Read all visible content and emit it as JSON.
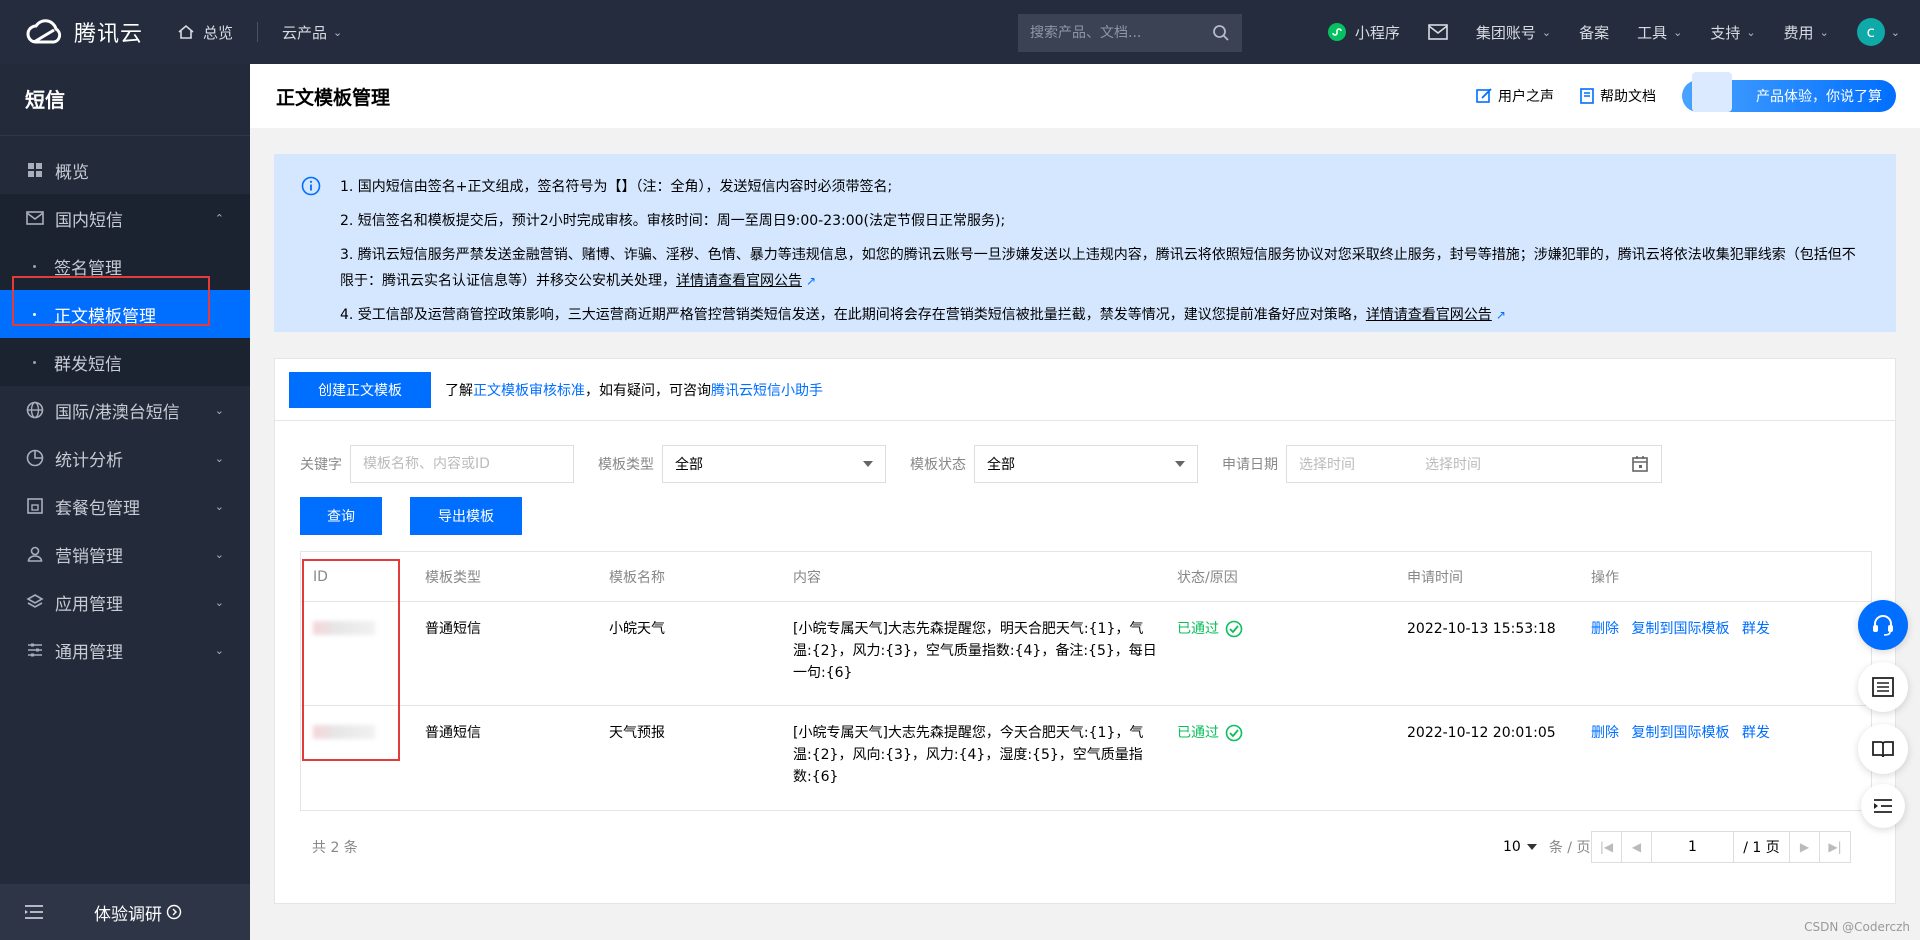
{
  "topbar": {
    "logo_text": "腾讯云",
    "home_label": "总览",
    "products_label": "云产品",
    "search_placeholder": "搜索产品、文档...",
    "mini_program": "小程序",
    "group_account": "集团账号",
    "beian": "备案",
    "tools": "工具",
    "support": "支持",
    "fees": "费用",
    "avatar_letter": "c"
  },
  "sidebar": {
    "title": "短信",
    "overview": "概览",
    "domestic": "国内短信",
    "sign_manage": "签名管理",
    "template_manage": "正文模板管理",
    "group_send": "群发短信",
    "intl": "国际/港澳台短信",
    "stats": "统计分析",
    "package": "套餐包管理",
    "marketing": "营销管理",
    "app_manage": "应用管理",
    "general": "通用管理",
    "survey": "体验调研"
  },
  "header": {
    "title": "正文模板管理",
    "user_voice": "用户之声",
    "help_doc": "帮助文档",
    "banner": "产品体验，你说了算"
  },
  "notice": {
    "items": [
      "1. 国内短信由签名+正文组成，签名符号为【】（注：全角），发送短信内容时必须带签名;",
      "2. 短信签名和模板提交后，预计2小时完成审核。审核时间：周一至周日9:00-23:00(法定节假日正常服务);",
      "3. 腾讯云短信服务严禁发送金融营销、赌博、诈骗、淫秽、色情、暴力等违规信息，如您的腾讯云账号一旦涉嫌发送以上违规内容，腾讯云将依照短信服务协议对您采取终止服务，封号等措施；涉嫌犯罪的，腾讯云将依法收集犯罪线索（包括但不限于：腾讯云实名认证信息等）并移交公安机关处理，",
      "4. 受工信部及运营商管控政策影响，三大运营商近期严格管控营销类短信发送，在此期间将会存在营销类短信被批量拦截，禁发等情况，建议您提前准备好应对策略，"
    ],
    "link3": "详情请查看官网公告",
    "link4": "详情请查看官网公告"
  },
  "toolbar": {
    "create_btn": "创建正文模板",
    "tip_prefix": "了解",
    "tip_link1": "正文模板审核标准",
    "tip_mid": "，如有疑问，可咨询",
    "tip_link2": "腾讯云短信小助手"
  },
  "filters": {
    "keyword_label": "关键字",
    "keyword_placeholder": "模板名称、内容或ID",
    "type_label": "模板类型",
    "type_value": "全部",
    "status_label": "模板状态",
    "status_value": "全部",
    "date_label": "申请日期",
    "date_start_placeholder": "选择时间",
    "date_end_placeholder": "选择时间",
    "query_btn": "查询",
    "export_btn": "导出模板"
  },
  "table": {
    "headers": [
      "ID",
      "模板类型",
      "模板名称",
      "内容",
      "状态/原因",
      "申请时间",
      "操作"
    ],
    "rows": [
      {
        "type": "普通短信",
        "name": "小皖天气",
        "content": "[小皖专属天气]大志先森提醒您，明天合肥天气:{1}，气温:{2}，风力:{3}，空气质量指数:{4}，备注:{5}，每日一句:{6}",
        "status": "已通过",
        "time": "2022-10-13 15:53:18",
        "ops": [
          "删除",
          "复制到国际模板",
          "群发"
        ]
      },
      {
        "type": "普通短信",
        "name": "天气预报",
        "content": "[小皖专属天气]大志先森提醒您，今天合肥天气:{1}，气温:{2}，风向:{3}，风力:{4}，湿度:{5}，空气质量指数:{6}",
        "status": "已通过",
        "time": "2022-10-12 20:01:05",
        "ops": [
          "删除",
          "复制到国际模板",
          "群发"
        ]
      }
    ]
  },
  "pager": {
    "total": "共 2 条",
    "page_size": "10",
    "unit": "条 / 页",
    "current": "1",
    "pages": "/ 1 页"
  },
  "watermark": "CSDN @Coderczh",
  "colors": {
    "primary": "#006eff",
    "topbar": "#242c3d",
    "sidebar": "#232b3a",
    "success": "#0abf5b",
    "highlight_box": "#e53a3a"
  }
}
